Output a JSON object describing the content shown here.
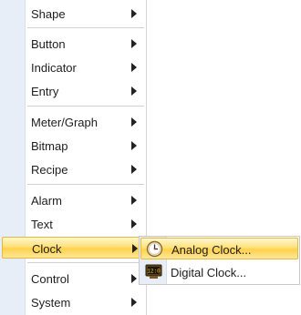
{
  "menu": {
    "items": [
      {
        "label": "Shape"
      },
      {
        "label": "Button"
      },
      {
        "label": "Indicator"
      },
      {
        "label": "Entry"
      },
      {
        "label": "Meter/Graph"
      },
      {
        "label": "Bitmap"
      },
      {
        "label": "Recipe"
      },
      {
        "label": "Alarm"
      },
      {
        "label": "Text"
      },
      {
        "label": "Clock"
      },
      {
        "label": "Control"
      },
      {
        "label": "System"
      }
    ],
    "active_item": "Clock"
  },
  "submenu": {
    "items": [
      {
        "label": "Analog Clock...",
        "icon": "analog-clock-icon"
      },
      {
        "label": "Digital Clock...",
        "icon": "digital-clock-icon"
      }
    ],
    "active_item": "Analog Clock..."
  },
  "colors": {
    "highlight": "#ffd24a",
    "highlight_border": "#e9b83a",
    "gutter": "#e8eef8"
  }
}
